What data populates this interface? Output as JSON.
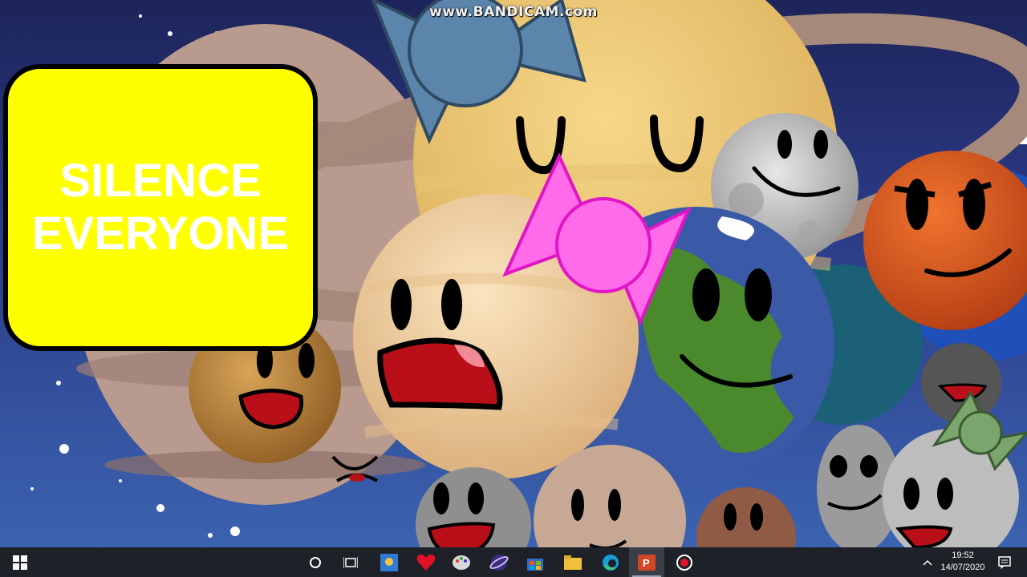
{
  "watermark": "www.BANDICAM.com",
  "sign": {
    "line1": "SILENCE",
    "line2": "EVERYONE",
    "color": "#ffff00"
  },
  "characters": [
    "Saturn",
    "Venus",
    "Earth",
    "Moon",
    "Mars",
    "Mercury",
    "Neptune",
    "Uranus",
    "Pluto"
  ],
  "taskbar": {
    "icons": [
      "windows-start-icon",
      "cortana-search-icon",
      "task-view-icon",
      "photo-app-icon",
      "heart-app-icon",
      "paint-app-icon",
      "space-app-icon",
      "store-icon",
      "file-explorer-icon",
      "edge-icon",
      "powerpoint-icon",
      "record-icon"
    ],
    "tray": {
      "time": "19:52",
      "date": "14/07/2020"
    }
  },
  "colors": {
    "sky": "#2b3a78",
    "taskbar": "#1e2228",
    "sign": "#ffff00"
  }
}
